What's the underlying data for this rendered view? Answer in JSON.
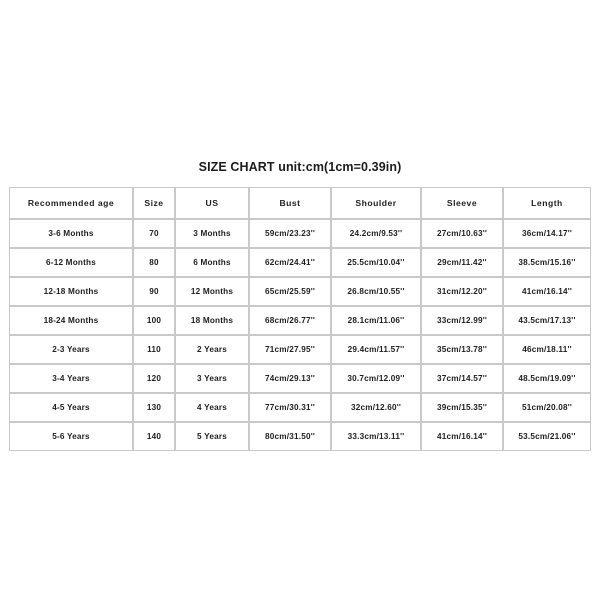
{
  "title": "SIZE CHART unit:cm(1cm=0.39in)",
  "chart_data": {
    "type": "table",
    "title": "SIZE CHART unit:cm(1cm=0.39in)",
    "columns": [
      "Recommended age",
      "Size",
      "US",
      "Bust",
      "Shoulder",
      "Sleeve",
      "Length"
    ],
    "rows": [
      [
        "3-6 Months",
        "70",
        "3 Months",
        "59cm/23.23''",
        "24.2cm/9.53''",
        "27cm/10.63''",
        "36cm/14.17''"
      ],
      [
        "6-12 Months",
        "80",
        "6 Months",
        "62cm/24.41''",
        "25.5cm/10.04''",
        "29cm/11.42''",
        "38.5cm/15.16''"
      ],
      [
        "12-18 Months",
        "90",
        "12 Months",
        "65cm/25.59''",
        "26.8cm/10.55''",
        "31cm/12.20''",
        "41cm/16.14''"
      ],
      [
        "18-24 Months",
        "100",
        "18 Months",
        "68cm/26.77''",
        "28.1cm/11.06''",
        "33cm/12.99''",
        "43.5cm/17.13''"
      ],
      [
        "2-3 Years",
        "110",
        "2 Years",
        "71cm/27.95''",
        "29.4cm/11.57''",
        "35cm/13.78''",
        "46cm/18.11''"
      ],
      [
        "3-4 Years",
        "120",
        "3 Years",
        "74cm/29.13''",
        "30.7cm/12.09''",
        "37cm/14.57''",
        "48.5cm/19.09''"
      ],
      [
        "4-5 Years",
        "130",
        "4 Years",
        "77cm/30.31''",
        "32cm/12.60''",
        "39cm/15.35''",
        "51cm/20.08''"
      ],
      [
        "5-6 Years",
        "140",
        "5 Years",
        "80cm/31.50''",
        "33.3cm/13.11''",
        "41cm/16.14''",
        "53.5cm/21.06''"
      ]
    ],
    "grid": true,
    "legend": "none"
  },
  "colors": {
    "background": "#ffffff",
    "border": "#c9c9c9",
    "text": "#1f1f1f"
  }
}
